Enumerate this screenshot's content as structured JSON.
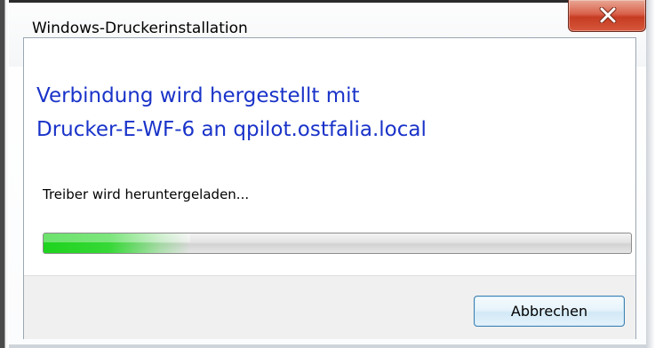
{
  "window": {
    "title": "Windows-Druckerinstallation"
  },
  "dialog": {
    "heading_line1": "Verbindung wird hergestellt mit",
    "heading_line2": "Drucker-E-WF-6 an qpilot.ostfalia.local",
    "status": "Treiber wird heruntergeladen...",
    "progress_percent": 25
  },
  "buttons": {
    "cancel_label": "Abbrechen"
  },
  "icons": {
    "close": "close-icon"
  },
  "colors": {
    "heading": "#1a33c9",
    "progress_green": "#1ed31e",
    "close_red": "#c63c22",
    "button_border": "#3c7fb1"
  }
}
